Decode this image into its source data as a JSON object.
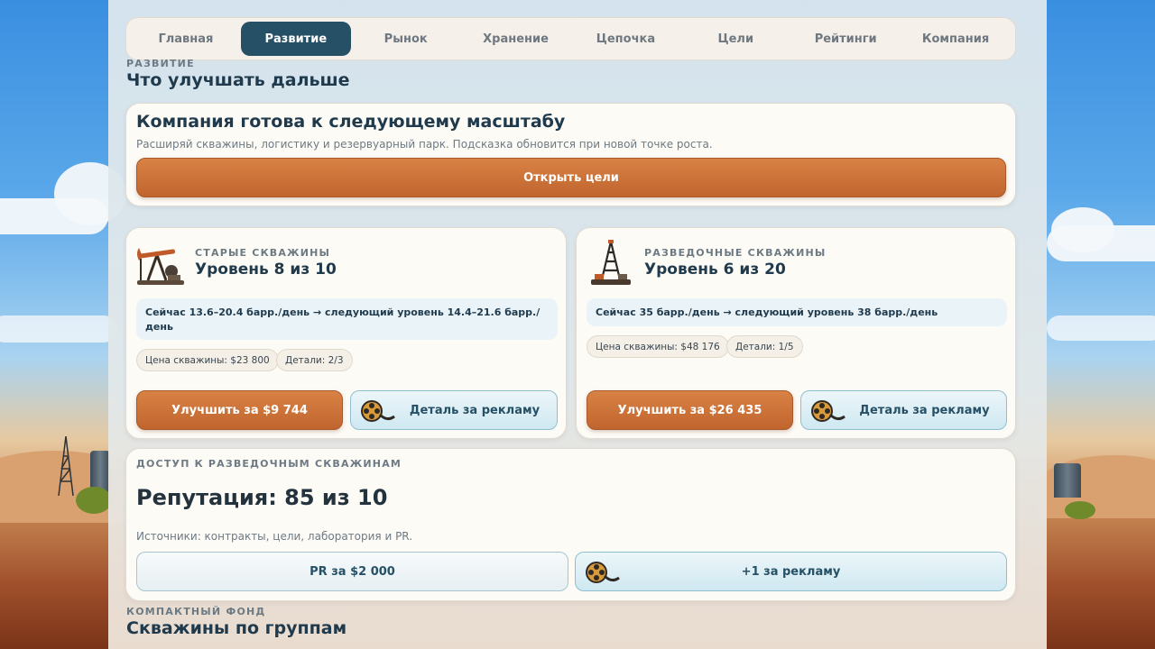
{
  "nav": {
    "tabs": [
      {
        "label": "Главная"
      },
      {
        "label": "Развитие",
        "active": true
      },
      {
        "label": "Рынок"
      },
      {
        "label": "Хранение"
      },
      {
        "label": "Цепочка"
      },
      {
        "label": "Цели"
      },
      {
        "label": "Рейтинги"
      },
      {
        "label": "Компания"
      }
    ]
  },
  "section": {
    "eyebrow": "РАЗВИТИЕ",
    "title": "Что улучшать дальше"
  },
  "hint_card": {
    "title": "Компания готова к следующему масштабу",
    "text": "Расширяй скважины, логистику и резервуарный парк. Подсказка обновится при новой точке роста.",
    "button_label": "Открыть цели"
  },
  "wells": [
    {
      "icon": "pumpjack-icon",
      "eyebrow": "СТАРЫЕ СКВАЖИНЫ",
      "level": "Уровень 8 из 10",
      "info": "Сейчас 13.6–20.4 барр./день → следующий уровень 14.4–21.6 барр./день",
      "price_chip": "Цена скважины: $23 800",
      "parts_chip": "Детали: 2/3",
      "upgrade_label": "Улучшить за $9 744",
      "ad_label": "Деталь за рекламу"
    },
    {
      "icon": "drilling-rig-icon",
      "eyebrow": "РАЗВЕДОЧНЫЕ СКВАЖИНЫ",
      "level": "Уровень 6 из 20",
      "info": "Сейчас 35 барр./день → следующий уровень 38 барр./день",
      "price_chip": "Цена скважины: $48 176",
      "parts_chip": "Детали: 1/5",
      "upgrade_label": "Улучшить за $26 435",
      "ad_label": "Деталь за рекламу"
    }
  ],
  "access_card": {
    "eyebrow": "ДОСТУП К РАЗВЕДОЧНЫМ СКВАЖИНАМ",
    "reputation": "Репутация: 85 из 10",
    "sources": "Источники: контракты, цели, лаборатория и PR.",
    "pr_label": "PR за $2 000",
    "ad_label": "+1 за рекламу"
  },
  "footer_section": {
    "eyebrow": "КОМПАКТНЫЙ ФОНД",
    "title": "Скважины по группам"
  },
  "colors": {
    "accent_dark": "#255066",
    "orange": "#c96d33",
    "ad_icon": "film-reel-icon"
  }
}
